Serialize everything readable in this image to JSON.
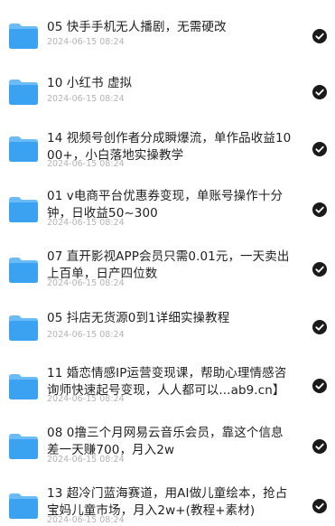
{
  "files": [
    {
      "title": "05 快手手机无人播剧，无需硬改",
      "date": "2024-06-15 08:24"
    },
    {
      "title": "10 小红书 虚拟",
      "date": "2024-06-15 08:24"
    },
    {
      "title": "14 视频号创作者分成瞬爆流，单作品收益1000+，小白落地实操教学",
      "date": "2024-06-15 08:24"
    },
    {
      "title": "01 v电商平台优惠券变现，单账号操作十分钟，日收益50~300",
      "date": "2024-06-15 08:24"
    },
    {
      "title": "07 直开影视APP会员只需0.01元，一天卖出上百单，日产四位数",
      "date": "2024-06-15 08:24"
    },
    {
      "title": "05 抖店无货源0到1详细实操教程",
      "date": "2024-06-15 08:24"
    },
    {
      "title": "11 婚恋情感IP运营变现课，帮助心理情感咨询师快速起号变现，人人都可以...ab9.cn】",
      "date": "2024-06-15 08:24"
    },
    {
      "title": "08 0撸三个月网易云音乐会员，靠这个信息差一天赚700，月入2w",
      "date": "2024-06-15 08:24"
    },
    {
      "title": "13 超冷门蓝海赛道，用AI做儿童绘本，抢占宝妈儿童市场，月入2w+(教程+素材)",
      "date": "2024-06-15 08:24"
    }
  ],
  "icons": {
    "folder": "folder-icon",
    "check": "check-circle-icon"
  },
  "colors": {
    "folder_main": "#3aa2f0",
    "folder_tab": "#6bbcf6",
    "check_bg": "#1a1a1a"
  }
}
